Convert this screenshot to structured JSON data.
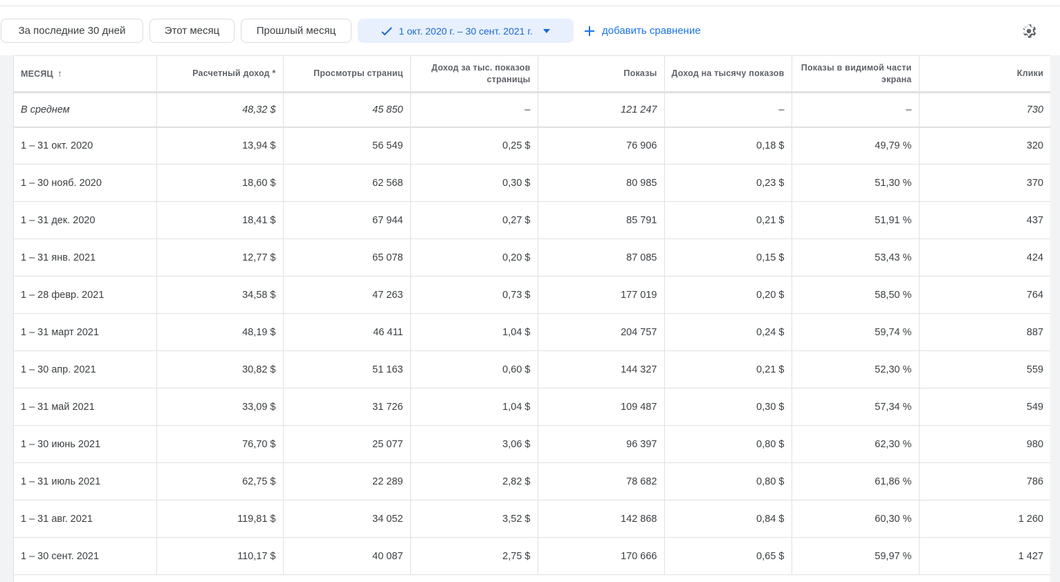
{
  "toolbar": {
    "presets": [
      "За последние 30 дней",
      "Этот месяц",
      "Прошлый месяц"
    ],
    "date_range": "1 окт. 2020 г. – 30 сент. 2021 г.",
    "add_comparison": "добавить сравнение",
    "accent": "#1a73e8"
  },
  "table": {
    "headers": [
      "МЕСЯЦ",
      "Расчетный доход *",
      "Просмотры страниц",
      "Доход за тыс. показов страницы",
      "Показы",
      "Доход на тысячу показов",
      "Показы в видимой части экрана",
      "Клики"
    ],
    "sort_icon": "↑",
    "average": [
      "В среднем",
      "48,32 $",
      "45 850",
      "–",
      "121 247",
      "–",
      "–",
      "730"
    ],
    "rows": [
      [
        "1 – 31 окт. 2020",
        "13,94 $",
        "56 549",
        "0,25 $",
        "76 906",
        "0,18 $",
        "49,79 %",
        "320"
      ],
      [
        "1 – 30 нояб. 2020",
        "18,60 $",
        "62 568",
        "0,30 $",
        "80 985",
        "0,23 $",
        "51,30 %",
        "370"
      ],
      [
        "1 – 31 дек. 2020",
        "18,41 $",
        "67 944",
        "0,27 $",
        "85 791",
        "0,21 $",
        "51,91 %",
        "437"
      ],
      [
        "1 – 31 янв. 2021",
        "12,77 $",
        "65 078",
        "0,20 $",
        "87 085",
        "0,15 $",
        "53,43 %",
        "424"
      ],
      [
        "1 – 28 февр. 2021",
        "34,58 $",
        "47 263",
        "0,73 $",
        "177 019",
        "0,20 $",
        "58,50 %",
        "764"
      ],
      [
        "1 – 31 март 2021",
        "48,19 $",
        "46 411",
        "1,04 $",
        "204 757",
        "0,24 $",
        "59,74 %",
        "887"
      ],
      [
        "1 – 30 апр. 2021",
        "30,82 $",
        "51 163",
        "0,60 $",
        "144 327",
        "0,21 $",
        "52,30 %",
        "559"
      ],
      [
        "1 – 31 май 2021",
        "33,09 $",
        "31 726",
        "1,04 $",
        "109 487",
        "0,30 $",
        "57,34 %",
        "549"
      ],
      [
        "1 – 30 июнь 2021",
        "76,70 $",
        "25 077",
        "3,06 $",
        "96 397",
        "0,80 $",
        "62,30 %",
        "980"
      ],
      [
        "1 – 31 июль 2021",
        "62,75 $",
        "22 289",
        "2,82 $",
        "78 682",
        "0,80 $",
        "61,86 %",
        "786"
      ],
      [
        "1 – 31 авг. 2021",
        "119,81 $",
        "34 052",
        "3,52 $",
        "142 868",
        "0,84 $",
        "60,30 %",
        "1 260"
      ],
      [
        "1 – 30 сент. 2021",
        "110,17 $",
        "40 087",
        "2,75 $",
        "170 666",
        "0,65 $",
        "59,97 %",
        "1 427"
      ]
    ]
  }
}
